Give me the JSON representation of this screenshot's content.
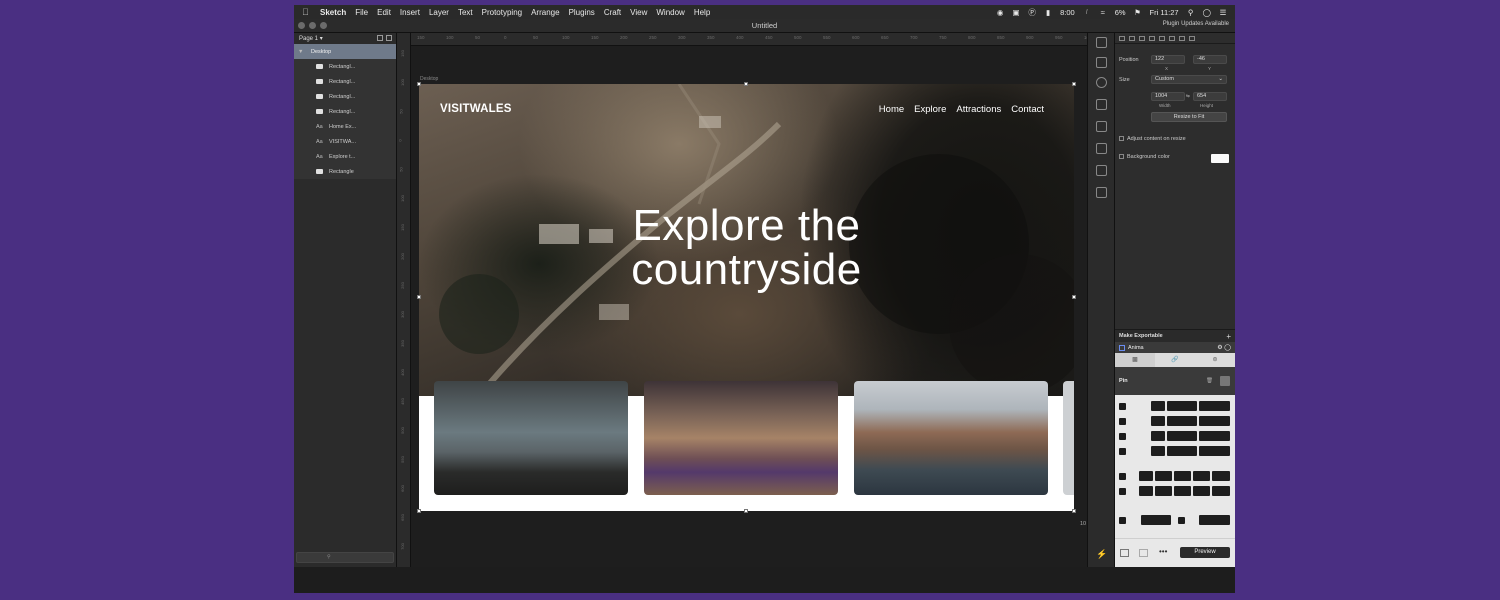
{
  "menubar": {
    "apple": "",
    "items": [
      "Sketch",
      "File",
      "Edit",
      "Insert",
      "Layer",
      "Text",
      "Prototyping",
      "Arrange",
      "Plugins",
      "Craft",
      "View",
      "Window",
      "Help"
    ],
    "clock_small": "8:00",
    "battery": "6%",
    "time": "Fri 11:27"
  },
  "window": {
    "title": "Untitled",
    "plugin_notice": "Plugin Updates Available"
  },
  "layers": {
    "page_label": "Page 1",
    "group": "Desktop",
    "items": [
      {
        "type": "rect",
        "label": "Rectangl..."
      },
      {
        "type": "rect",
        "label": "Rectangl..."
      },
      {
        "type": "rect",
        "label": "Rectangl..."
      },
      {
        "type": "rect",
        "label": "Rectangl..."
      },
      {
        "type": "text",
        "label": "Home Ex..."
      },
      {
        "type": "text",
        "label": "VISITWA..."
      },
      {
        "type": "text",
        "label": "Explore t..."
      },
      {
        "type": "rect",
        "label": "Rectangle"
      }
    ],
    "text_icon": "Aa"
  },
  "ruler": {
    "ticks": [
      "150",
      "100",
      "50",
      "0",
      "50",
      "100",
      "150",
      "200",
      "250",
      "300",
      "350",
      "400",
      "450",
      "500",
      "550",
      "600",
      "650",
      "700",
      "750",
      "800",
      "850",
      "900",
      "950",
      "1000"
    ]
  },
  "canvas": {
    "artboard_label": "Desktop",
    "size_label": "10"
  },
  "site": {
    "brand": "VISITWALES",
    "nav": [
      "Home",
      "Explore",
      "Attractions",
      "Contact"
    ],
    "hero_line1": "Explore the",
    "hero_line2": "countryside"
  },
  "inspector": {
    "position_label": "Position",
    "x_value": "122",
    "y_value": "-46",
    "x_sub": "X",
    "y_sub": "Y",
    "size_label": "Size",
    "size_preset": "Custom",
    "width_value": "1004",
    "height_value": "654",
    "width_sub": "Width",
    "height_sub": "Height",
    "resize_button": "Resize to Fit",
    "adjust_label": "Adjust content on resize",
    "bg_label": "Background color",
    "bg_color": "#fafafa",
    "export_label": "Make Exportable",
    "plus": "+",
    "anima_label": "Anima",
    "pin_label": "Pin",
    "preview_label": "Preview"
  },
  "colors": {
    "backdrop": "#4a2f82",
    "selection": "#ffffff"
  }
}
